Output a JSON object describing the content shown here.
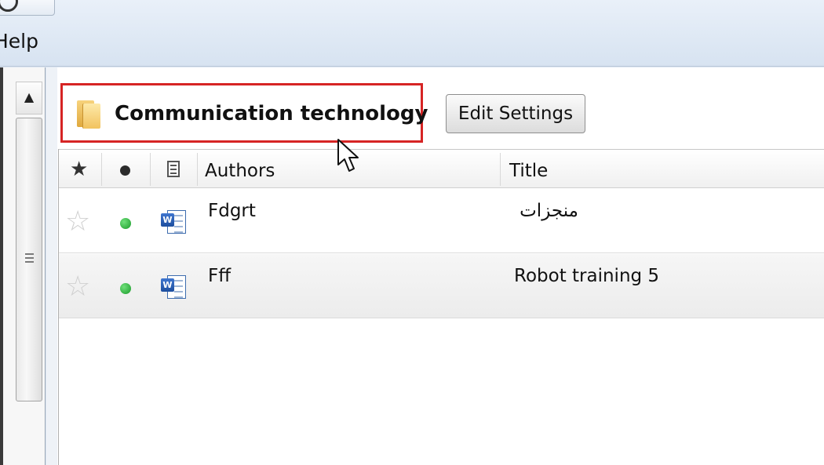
{
  "menu": {
    "help_label": "Help"
  },
  "collection": {
    "name": "Communication technology",
    "edit_settings_label": "Edit Settings"
  },
  "table": {
    "columns": {
      "authors": "Authors",
      "title": "Title"
    },
    "rows": [
      {
        "author": "Fdgrt",
        "title": "منجزات",
        "starred": false,
        "status_color": "#22a533",
        "file_type": "word"
      },
      {
        "author": "Fff",
        "title": "Robot training 5",
        "starred": false,
        "status_color": "#22a533",
        "file_type": "word"
      }
    ]
  },
  "icons": {
    "header_star": "star-filled",
    "header_status": "dot",
    "header_file": "document",
    "row_star": "star-outline",
    "row_file": "word-document",
    "folder": "folder",
    "cursor": "mouse-pointer"
  },
  "colors": {
    "highlight_border": "#d62424",
    "status_green": "#22a533",
    "toolbar_bg": "#dce6f2"
  }
}
